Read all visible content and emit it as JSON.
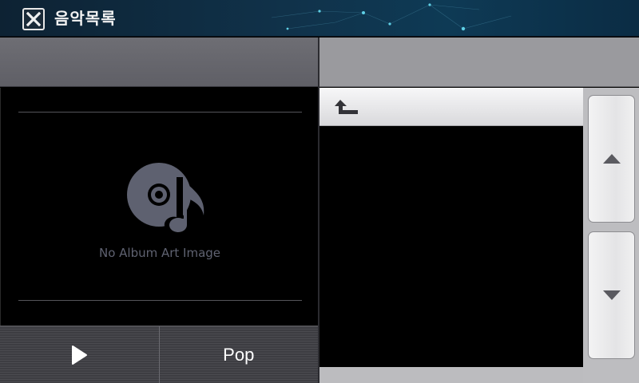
{
  "titlebar": {
    "title": "음악목록"
  },
  "album": {
    "no_art_text": "No Album Art Image"
  },
  "controls": {
    "genre_label": "Pop"
  },
  "colors": {
    "titlebar": "#10324a",
    "panel_header_left": "#66666c",
    "panel_header_right": "#9a9a9e",
    "no_art_text": "#5f6271"
  },
  "icons": {
    "close": "close-icon",
    "album": "cd-music-note-icon",
    "play": "play-icon",
    "up_folder": "return-up-icon",
    "scroll_up": "triangle-up-icon",
    "scroll_down": "triangle-down-icon"
  }
}
